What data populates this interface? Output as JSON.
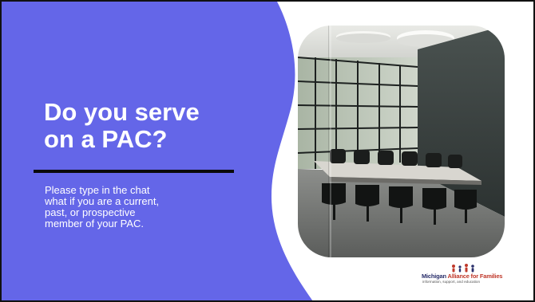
{
  "slide": {
    "title_line1": "Do you serve",
    "title_line2": "on a PAC?",
    "body_lines": [
      "Please type in the chat",
      "what if you are a current,",
      "past, or prospective",
      "member of your PAC."
    ]
  },
  "logo": {
    "name_part1": "Michigan ",
    "name_part2": "Alliance for Families",
    "tagline": "information, support, and education"
  },
  "colors": {
    "panel": "#6466e8",
    "text": "#ffffff",
    "rule": "#0a0a0a",
    "logo_navy": "#2a2f6b",
    "logo_red": "#c0392b"
  },
  "photo": {
    "icon": "conference-room-photo"
  }
}
